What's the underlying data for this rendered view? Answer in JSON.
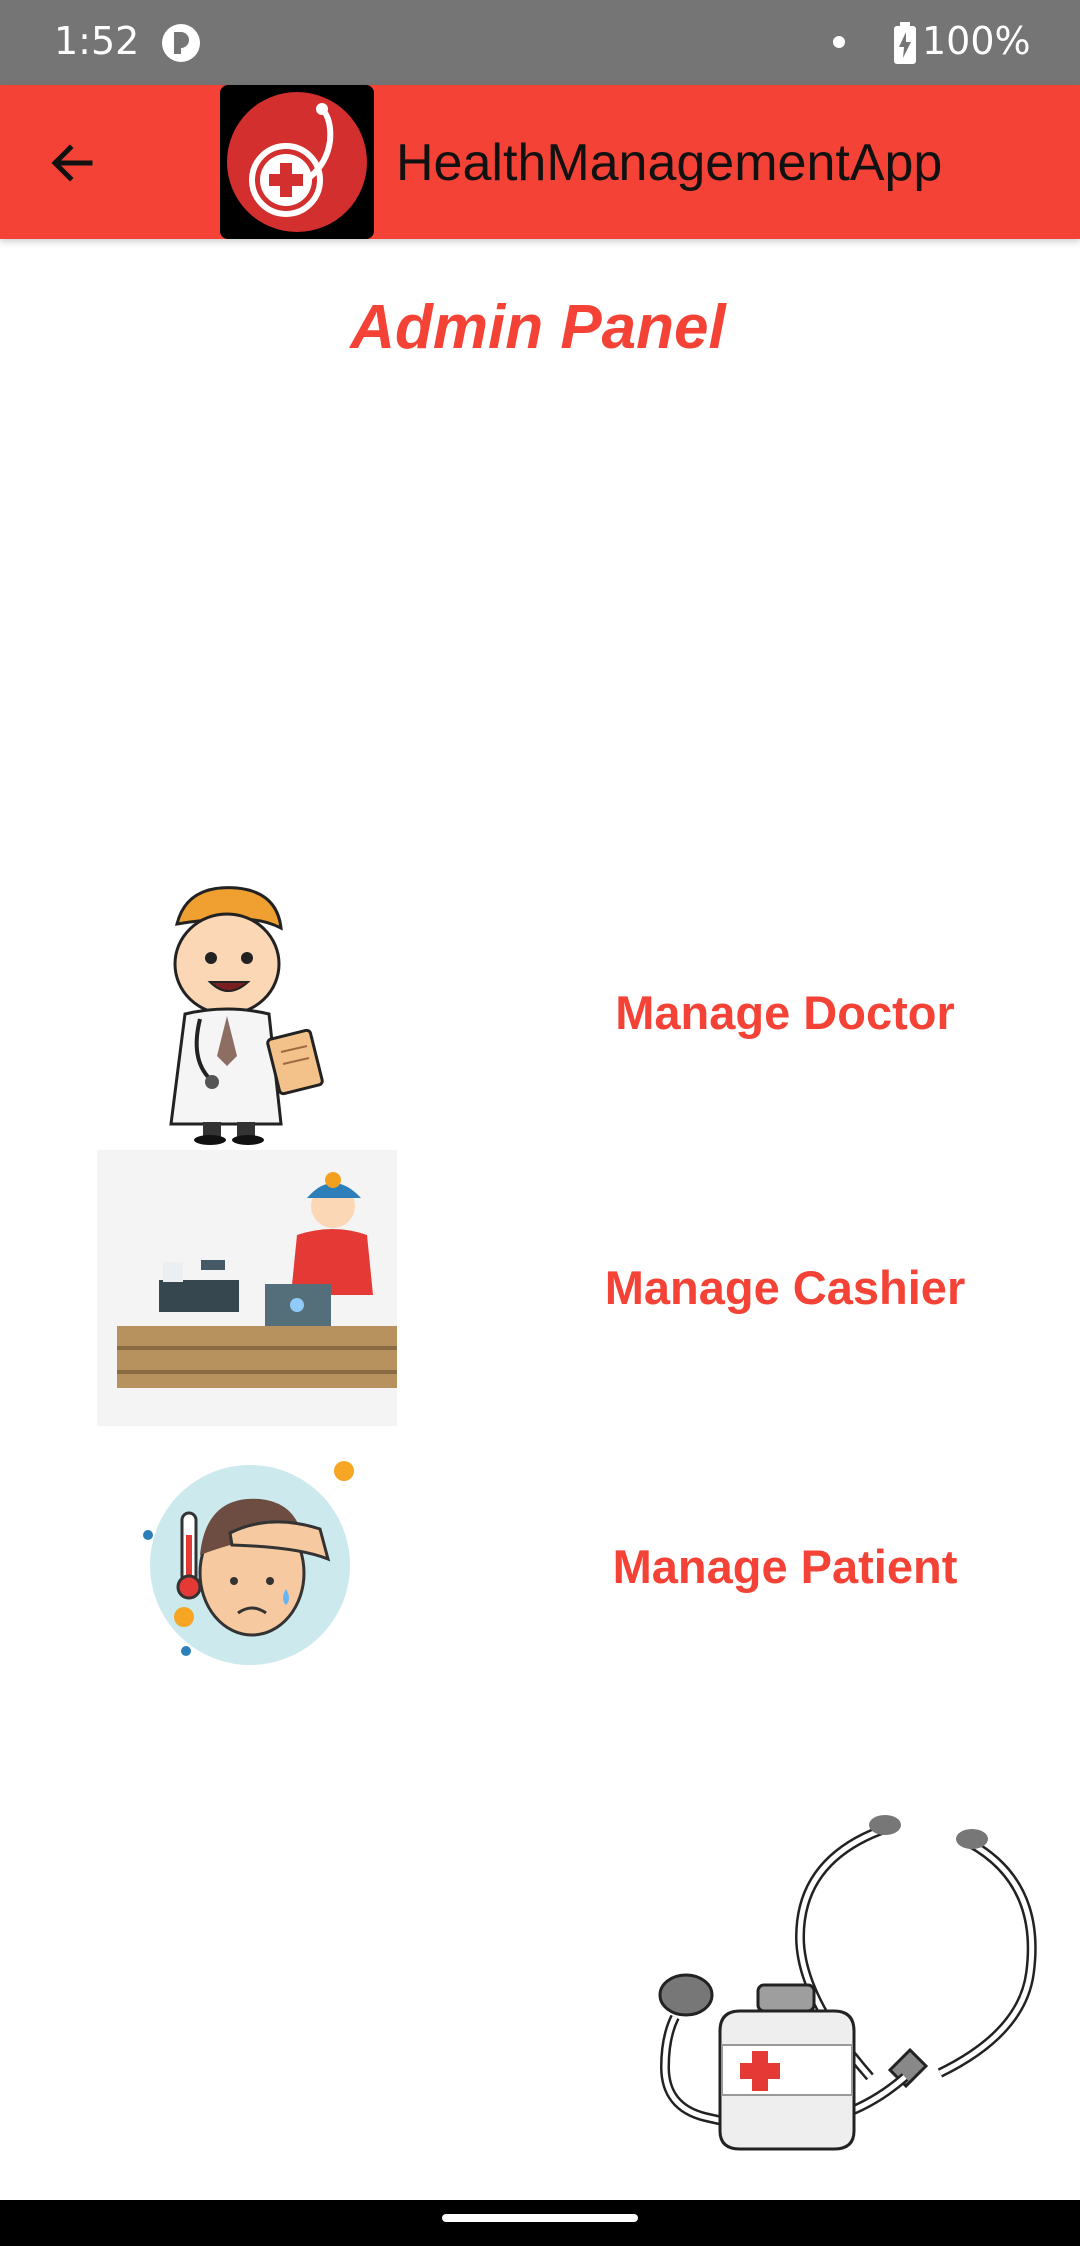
{
  "status_bar": {
    "time": "1:52",
    "battery": "100%"
  },
  "app_bar": {
    "title": "HealthManagementApp",
    "back_icon": "arrow-left-icon",
    "logo_icon": "stethoscope-medical-cross-icon"
  },
  "page": {
    "title": "Admin Panel"
  },
  "menu": {
    "items": [
      {
        "label": "Manage Doctor",
        "image": "doctor-illustration"
      },
      {
        "label": "Manage Cashier",
        "image": "cashier-illustration"
      },
      {
        "label": "Manage Patient",
        "image": "sick-patient-illustration"
      }
    ]
  },
  "colors": {
    "primary": "#f44336",
    "status_bar": "#757575",
    "title_text": "#111111"
  }
}
